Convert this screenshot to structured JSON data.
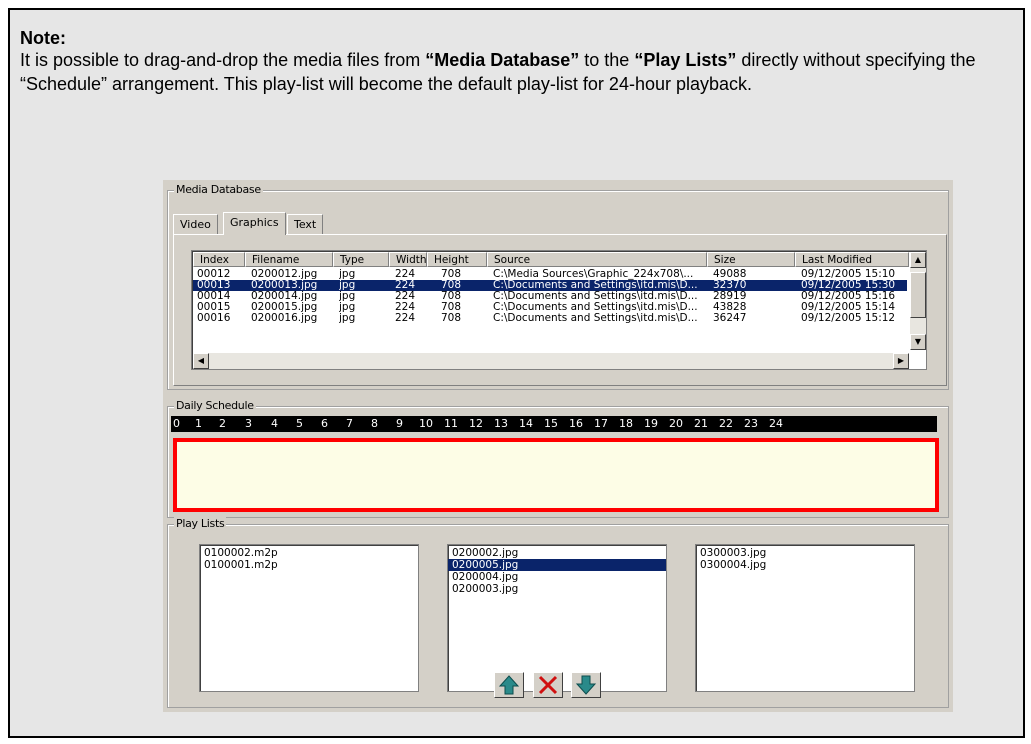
{
  "note": {
    "title": "Note:",
    "line1_prefix": "It is possible to drag-and-drop the media files from ",
    "media_database": "“Media Database”",
    "line1_mid": " to the ",
    "play_lists": "“Play Lists”",
    "line1_suffix": " directly without specifying the “Schedule” arrangement. This play-list will become the default play-list for 24-hour playback."
  },
  "media_database": {
    "label": "Media Database",
    "tabs": [
      "Video",
      "Graphics",
      "Text"
    ],
    "active_tab": "Graphics",
    "columns": [
      "Index",
      "Filename",
      "Type",
      "Width",
      "Height",
      "Source",
      "Size",
      "Last Modified"
    ],
    "rows": [
      {
        "index": "00012",
        "filename": "0200012.jpg",
        "type": "jpg",
        "width": "224",
        "height": "708",
        "source": "C:\\Media Sources\\Graphic_224x708\\...",
        "size": "49088",
        "modified": "09/12/2005 15:10",
        "selected": false
      },
      {
        "index": "00013",
        "filename": "0200013.jpg",
        "type": "jpg",
        "width": "224",
        "height": "708",
        "source": "C:\\Documents and Settings\\itd.mis\\D...",
        "size": "32370",
        "modified": "09/12/2005 15:30",
        "selected": true
      },
      {
        "index": "00014",
        "filename": "0200014.jpg",
        "type": "jpg",
        "width": "224",
        "height": "708",
        "source": "C:\\Documents and Settings\\itd.mis\\D...",
        "size": "28919",
        "modified": "09/12/2005 15:16",
        "selected": false
      },
      {
        "index": "00015",
        "filename": "0200015.jpg",
        "type": "jpg",
        "width": "224",
        "height": "708",
        "source": "C:\\Documents and Settings\\itd.mis\\D...",
        "size": "43828",
        "modified": "09/12/2005 15:14",
        "selected": false
      },
      {
        "index": "00016",
        "filename": "0200016.jpg",
        "type": "jpg",
        "width": "224",
        "height": "708",
        "source": "C:\\Documents and Settings\\itd.mis\\D...",
        "size": "36247",
        "modified": "09/12/2005 15:12",
        "selected": false
      }
    ]
  },
  "daily_schedule": {
    "label": "Daily Schedule",
    "hours": [
      "0",
      "1",
      "2",
      "3",
      "4",
      "5",
      "6",
      "7",
      "8",
      "9",
      "10",
      "11",
      "12",
      "13",
      "14",
      "15",
      "16",
      "17",
      "18",
      "19",
      "20",
      "21",
      "22",
      "23",
      "24"
    ],
    "highlight_color": "#ff0000"
  },
  "play_lists": {
    "label": "Play Lists",
    "lists": [
      {
        "items": [
          "0100002.m2p",
          "0100001.m2p"
        ],
        "selected": -1
      },
      {
        "items": [
          "0200002.jpg",
          "0200005.jpg",
          "0200004.jpg",
          "0200003.jpg"
        ],
        "selected": 1
      },
      {
        "items": [
          "0300003.jpg",
          "0300004.jpg"
        ],
        "selected": -1
      }
    ],
    "buttons": [
      "move-up",
      "delete",
      "move-down"
    ]
  },
  "colors": {
    "selection": "#0a246a",
    "ruler_bg": "#000000",
    "schedule_bg": "#fdfde6",
    "button_arrow": "#2a8a8a",
    "delete_x": "#d01010"
  }
}
